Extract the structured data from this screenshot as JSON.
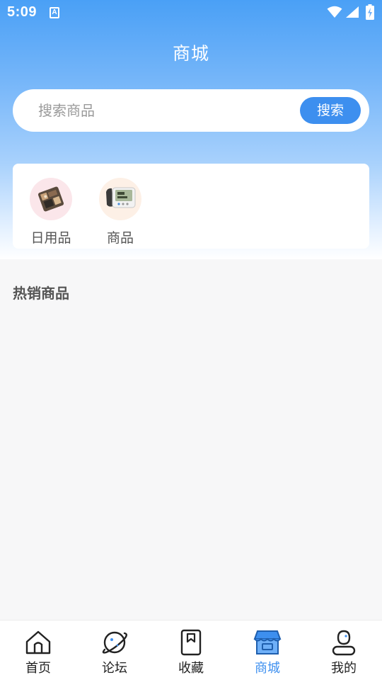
{
  "status_bar": {
    "time": "5:09",
    "notification_icon_letter": "A"
  },
  "header": {
    "title": "商城"
  },
  "search": {
    "placeholder": "搜索商品",
    "value": "",
    "button_label": "搜索"
  },
  "categories": [
    {
      "label": "日用品",
      "icon": "daily-goods-thumbnail"
    },
    {
      "label": "商品",
      "icon": "blood-pressure-monitor-thumbnail"
    }
  ],
  "section": {
    "title": "热销商品"
  },
  "tab_bar": {
    "tabs": [
      {
        "label": "首页",
        "icon": "home-icon",
        "active": false
      },
      {
        "label": "论坛",
        "icon": "planet-icon",
        "active": false
      },
      {
        "label": "收藏",
        "icon": "bookmark-icon",
        "active": false
      },
      {
        "label": "商城",
        "icon": "store-icon",
        "active": true
      },
      {
        "label": "我的",
        "icon": "user-icon",
        "active": false
      }
    ],
    "active_color": "#3d8fef"
  },
  "colors": {
    "primary": "#3d8fef",
    "header_gradient_top": "#4aa0f6"
  }
}
